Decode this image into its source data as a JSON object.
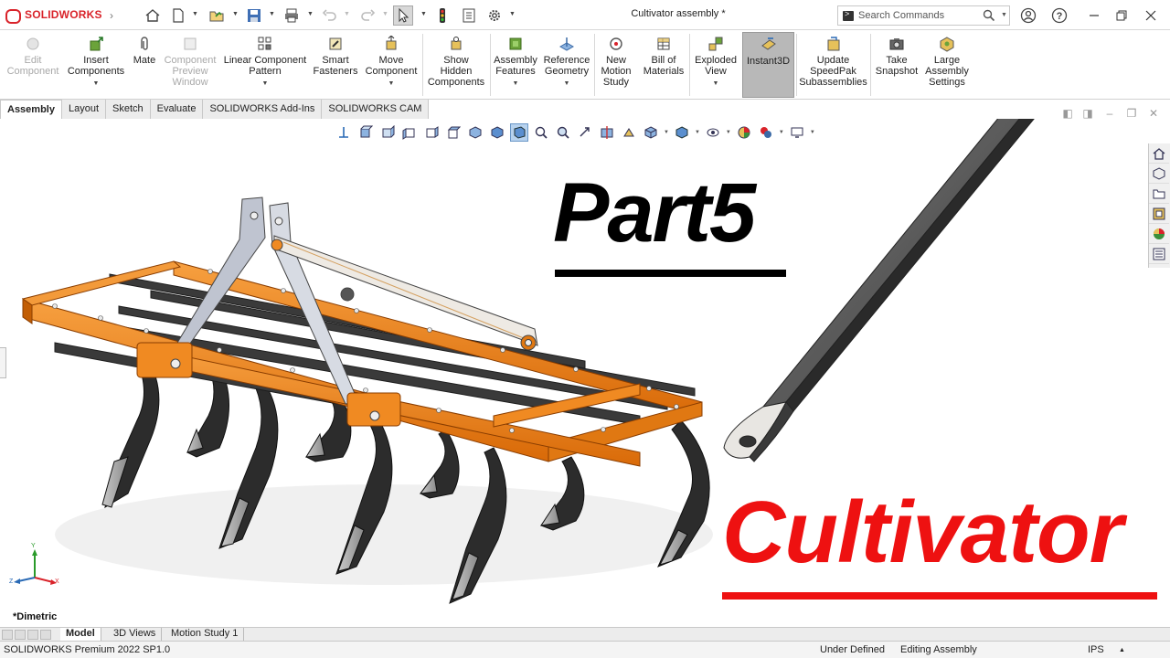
{
  "app": {
    "brand_bold": "SOLIDWORKS",
    "window_title": "Cultivator assembly *"
  },
  "search": {
    "placeholder": "Search Commands"
  },
  "command_manager": {
    "items": [
      {
        "label": "Edit\nComponent",
        "icon": "edit-component-icon",
        "enabled": false
      },
      {
        "label": "Insert\nComponents",
        "icon": "insert-components-icon",
        "enabled": true
      },
      {
        "label": "Mate",
        "icon": "mate-icon",
        "enabled": true
      },
      {
        "label": "Component\nPreview\nWindow",
        "icon": "component-preview-icon",
        "enabled": false
      },
      {
        "label": "Linear Component\nPattern",
        "icon": "linear-pattern-icon",
        "enabled": true
      },
      {
        "label": "Smart\nFasteners",
        "icon": "smart-fasteners-icon",
        "enabled": true
      },
      {
        "label": "Move\nComponent",
        "icon": "move-component-icon",
        "enabled": true
      },
      {
        "label": "Show\nHidden\nComponents",
        "icon": "show-hidden-icon",
        "enabled": true
      },
      {
        "label": "Assembly\nFeatures",
        "icon": "assembly-features-icon",
        "enabled": true
      },
      {
        "label": "Reference\nGeometry",
        "icon": "reference-geometry-icon",
        "enabled": true
      },
      {
        "label": "New\nMotion\nStudy",
        "icon": "motion-study-icon",
        "enabled": true
      },
      {
        "label": "Bill of\nMaterials",
        "icon": "bom-icon",
        "enabled": true
      },
      {
        "label": "Exploded\nView",
        "icon": "exploded-view-icon",
        "enabled": true
      },
      {
        "label": "Instant3D",
        "icon": "instant3d-icon",
        "enabled": true,
        "active": true
      },
      {
        "label": "Update\nSpeedPak\nSubassemblies",
        "icon": "speedpak-icon",
        "enabled": true
      },
      {
        "label": "Take\nSnapshot",
        "icon": "snapshot-icon",
        "enabled": true
      },
      {
        "label": "Large\nAssembly\nSettings",
        "icon": "large-assembly-icon",
        "enabled": true
      }
    ]
  },
  "tabs": [
    "Assembly",
    "Layout",
    "Sketch",
    "Evaluate",
    "SOLIDWORKS Add-Ins",
    "SOLIDWORKS CAM"
  ],
  "overlay": {
    "part_title": "Part5",
    "subject_title": "Cultivator"
  },
  "view": {
    "orientation_label": "*Dimetric"
  },
  "triad": {
    "x": "X",
    "y": "Y",
    "z": "Z"
  },
  "bottom_tabs": [
    "Model",
    "3D Views",
    "Motion Study 1"
  ],
  "status": {
    "product": "SOLIDWORKS Premium 2022 SP1.0",
    "definition": "Under Defined",
    "mode": "Editing Assembly",
    "units": "IPS"
  },
  "colors": {
    "frame_orange": "#f07d14",
    "tine_black": "#2a2a2a",
    "accent_red": "#ee1111",
    "part_gray": "#5c5c5c"
  }
}
